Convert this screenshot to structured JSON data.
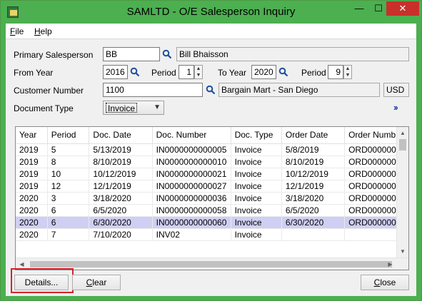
{
  "window": {
    "title": "SAMLTD - O/E Salesperson Inquiry",
    "minimize": "—",
    "maximize": "☐",
    "close": "✕"
  },
  "menu": {
    "file_mnemonic": "F",
    "file_rest": "ile",
    "help_mnemonic": "H",
    "help_rest": "elp"
  },
  "form": {
    "primary_salesperson_label": "Primary Salesperson",
    "primary_salesperson_value": "BB",
    "primary_salesperson_name": "Bill Bhaisson",
    "from_year_label": "From Year",
    "from_year_value": "2016",
    "from_period_label": "Period",
    "from_period_value": "1",
    "to_year_label": "To Year",
    "to_year_value": "2020",
    "to_period_label": "Period",
    "to_period_value": "9",
    "customer_number_label": "Customer Number",
    "customer_number_value": "1100",
    "customer_name": "Bargain Mart - San Diego",
    "currency": "USD",
    "document_type_label": "Document Type",
    "document_type_value": "Invoice"
  },
  "grid": {
    "columns": [
      "Year",
      "Period",
      "Doc. Date",
      "Doc. Number",
      "Doc. Type",
      "Order Date",
      "Order Numb"
    ],
    "rows": [
      [
        "2019",
        "5",
        "5/13/2019",
        "IN0000000000005",
        "Invoice",
        "5/8/2019",
        "ORD000000"
      ],
      [
        "2019",
        "8",
        "8/10/2019",
        "IN0000000000010",
        "Invoice",
        "8/10/2019",
        "ORD000000"
      ],
      [
        "2019",
        "10",
        "10/12/2019",
        "IN0000000000021",
        "Invoice",
        "10/12/2019",
        "ORD000000"
      ],
      [
        "2019",
        "12",
        "12/1/2019",
        "IN0000000000027",
        "Invoice",
        "12/1/2019",
        "ORD000000"
      ],
      [
        "2020",
        "3",
        "3/18/2020",
        "IN0000000000036",
        "Invoice",
        "3/18/2020",
        "ORD000000"
      ],
      [
        "2020",
        "6",
        "6/5/2020",
        "IN0000000000058",
        "Invoice",
        "6/5/2020",
        "ORD000000"
      ],
      [
        "2020",
        "6",
        "6/30/2020",
        "IN0000000000060",
        "Invoice",
        "6/30/2020",
        "ORD000000"
      ],
      [
        "2020",
        "7",
        "7/10/2020",
        "INV02",
        "Invoice",
        "",
        ""
      ]
    ],
    "selected_row": 6
  },
  "buttons": {
    "details": "Details...",
    "clear_mnemonic": "C",
    "clear_rest": "lear",
    "close_mnemonic": "C",
    "close_rest": "lose"
  },
  "colors": {
    "titlebar": "#4caf50",
    "selection": "#cfcff3",
    "close_button": "#c7312a",
    "highlight": "#d4232b",
    "lookup_icon": "#1c4f9c"
  }
}
